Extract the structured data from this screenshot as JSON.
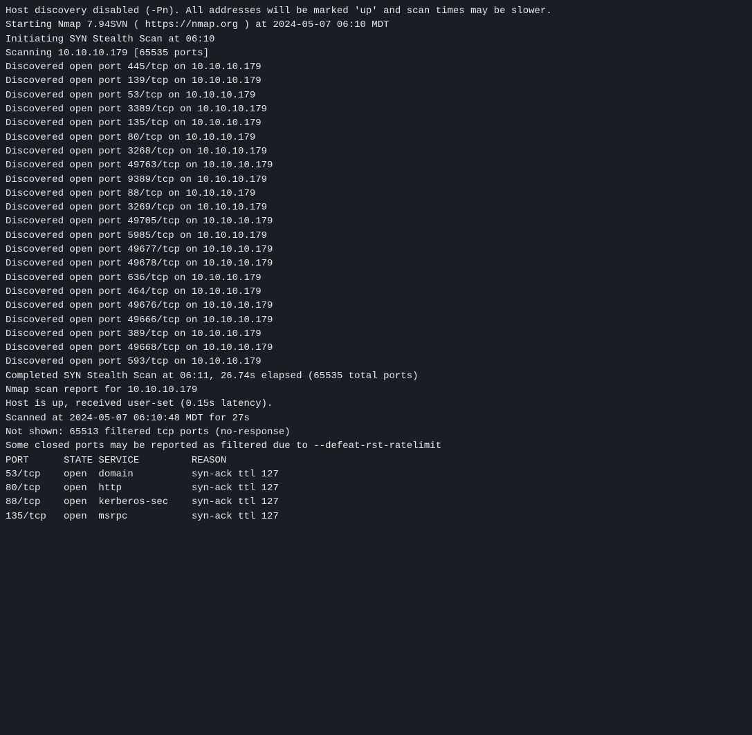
{
  "terminal": {
    "lines": [
      "Host discovery disabled (-Pn). All addresses will be marked 'up' and scan times may be slower.",
      "Starting Nmap 7.94SVN ( https://nmap.org ) at 2024-05-07 06:10 MDT",
      "Initiating SYN Stealth Scan at 06:10",
      "Scanning 10.10.10.179 [65535 ports]",
      "Discovered open port 445/tcp on 10.10.10.179",
      "Discovered open port 139/tcp on 10.10.10.179",
      "Discovered open port 53/tcp on 10.10.10.179",
      "Discovered open port 3389/tcp on 10.10.10.179",
      "Discovered open port 135/tcp on 10.10.10.179",
      "Discovered open port 80/tcp on 10.10.10.179",
      "Discovered open port 3268/tcp on 10.10.10.179",
      "Discovered open port 49763/tcp on 10.10.10.179",
      "Discovered open port 9389/tcp on 10.10.10.179",
      "Discovered open port 88/tcp on 10.10.10.179",
      "Discovered open port 3269/tcp on 10.10.10.179",
      "Discovered open port 49705/tcp on 10.10.10.179",
      "Discovered open port 5985/tcp on 10.10.10.179",
      "Discovered open port 49677/tcp on 10.10.10.179",
      "Discovered open port 49678/tcp on 10.10.10.179",
      "Discovered open port 636/tcp on 10.10.10.179",
      "Discovered open port 464/tcp on 10.10.10.179",
      "Discovered open port 49676/tcp on 10.10.10.179",
      "Discovered open port 49666/tcp on 10.10.10.179",
      "Discovered open port 389/tcp on 10.10.10.179",
      "Discovered open port 49668/tcp on 10.10.10.179",
      "Discovered open port 593/tcp on 10.10.10.179",
      "Completed SYN Stealth Scan at 06:11, 26.74s elapsed (65535 total ports)",
      "Nmap scan report for 10.10.10.179",
      "Host is up, received user-set (0.15s latency).",
      "Scanned at 2024-05-07 06:10:48 MDT for 27s",
      "Not shown: 65513 filtered tcp ports (no-response)",
      "Some closed ports may be reported as filtered due to --defeat-rst-ratelimit",
      "PORT      STATE SERVICE         REASON",
      "53/tcp    open  domain          syn-ack ttl 127",
      "80/tcp    open  http            syn-ack ttl 127",
      "88/tcp    open  kerberos-sec    syn-ack ttl 127",
      "135/tcp   open  msrpc           syn-ack ttl 127"
    ]
  }
}
